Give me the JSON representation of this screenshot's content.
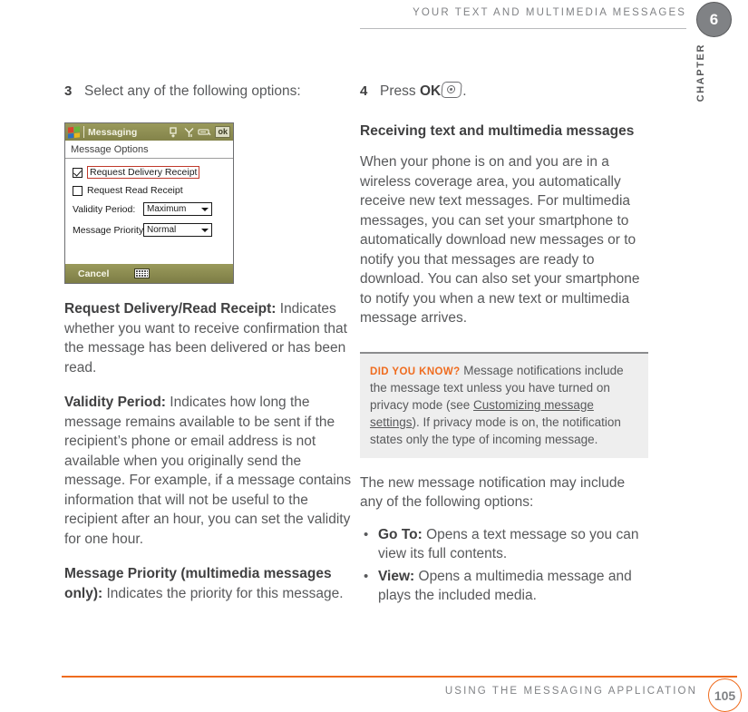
{
  "header": {
    "running_title": "YOUR TEXT AND MULTIMEDIA MESSAGES",
    "chapter_number": "6",
    "chapter_word": "CHAPTER"
  },
  "left_column": {
    "step": {
      "number": "3",
      "text": "Select any of the following options:"
    },
    "device_screenshot": {
      "titlebar": {
        "app_title": "Messaging",
        "ok_button": "ok"
      },
      "subtitle": "Message Options",
      "checkboxes": [
        {
          "label": "Request Delivery Receipt",
          "checked": true,
          "focused": true
        },
        {
          "label": "Request Read Receipt",
          "checked": false,
          "focused": false
        }
      ],
      "fields": [
        {
          "label": "Validity Period:",
          "value": "Maximum"
        },
        {
          "label": "Message Priority:",
          "value": "Normal"
        }
      ],
      "softkey_left": "Cancel"
    },
    "definitions": [
      {
        "term": "Request Delivery/Read Receipt:",
        "definition": " Indicates whether you want to receive confirmation that the message has been delivered or has been read."
      },
      {
        "term": "Validity Period:",
        "definition": " Indicates how long the message remains available to be sent if the recipient’s phone or email address is not available when you originally send the message. For example, if a message contains information that will not be useful to the recipient after an hour, you can set the validity for one hour."
      },
      {
        "term": "Message Priority (multimedia messages only):",
        "definition": " Indicates the priority for this message."
      }
    ]
  },
  "right_column": {
    "step": {
      "number": "4",
      "text_before": "Press ",
      "bold_label": "OK",
      "text_after": "."
    },
    "section_heading": "Receiving text and multimedia messages",
    "intro_paragraph": "When your phone is on and you are in a wireless coverage area, you automatically receive new text messages. For multimedia messages, you can set your smartphone to automatically download new messages or to notify you that messages are ready to download. You can also set your smartphone to notify you when a new text or multimedia message arrives.",
    "tip_box": {
      "label": "DID YOU KNOW?",
      "text_part1": " Message notifications include the message text unless you have turned on privacy mode (see ",
      "link_text": "Customizing message settings",
      "text_part2": "). If privacy mode is on, the notification states only the type of incoming message."
    },
    "list_intro": "The new message notification may include any of the following options:",
    "bullets": [
      {
        "term": "Go To:",
        "text": " Opens a text message so you can view its full contents."
      },
      {
        "term": "View:",
        "text": " Opens a multimedia message and plays the included media."
      }
    ]
  },
  "footer": {
    "title": "USING THE MESSAGING APPLICATION",
    "page_number": "105",
    "accent_color": "#ef6c1f"
  }
}
